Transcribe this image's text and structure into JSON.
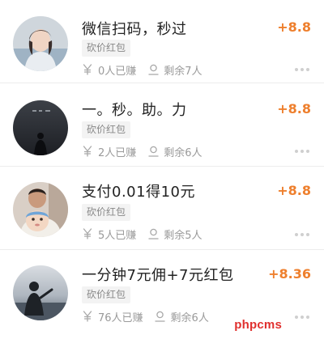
{
  "colors": {
    "amount": "#ee7f2d",
    "watermark": "#e0302e",
    "divider": "#ececec",
    "tag_bg": "#f3f3f3"
  },
  "tasks": [
    {
      "title": "微信扫码，秒过",
      "amount": "+8.8",
      "tag": "砍价红包",
      "earned": "0人已赚",
      "remaining": "剩余7人",
      "avatar_icon": "girl-portrait-avatar"
    },
    {
      "title": "一。秒。助。力",
      "amount": "+8.8",
      "tag": "砍价红包",
      "earned": "2人已赚",
      "remaining": "剩余6人",
      "avatar_icon": "silhouette-night-avatar"
    },
    {
      "title": "支付0.01得10元",
      "amount": "+8.8",
      "tag": "砍价红包",
      "earned": "5人已赚",
      "remaining": "剩余5人",
      "avatar_icon": "baby-family-photo-avatar"
    },
    {
      "title": "一分钟7元佣+7元红包",
      "amount": "+8.36",
      "tag": "砍价红包",
      "earned": "76人已赚",
      "remaining": "剩余6人",
      "avatar_icon": "seaside-figure-avatar"
    }
  ],
  "watermark": "phpcms"
}
